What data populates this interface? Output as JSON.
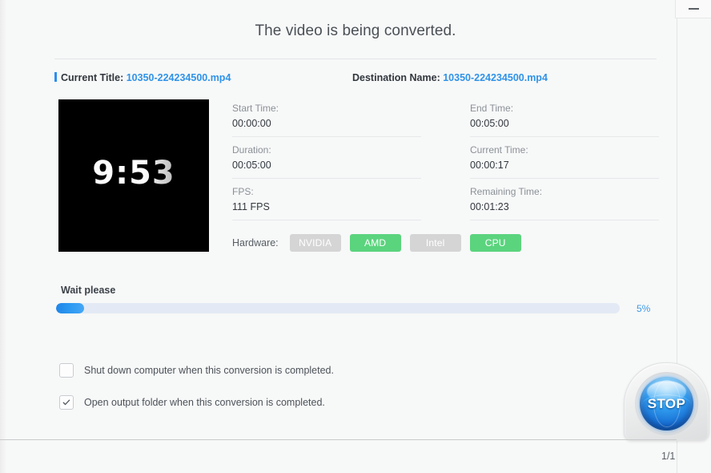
{
  "window": {
    "minimize_label": "minimize"
  },
  "header": {
    "title": "The video is being converted."
  },
  "title_row": {
    "current_label": "Current Title:",
    "current_value": "10350-224234500.mp4",
    "destination_label": "Destination Name:",
    "destination_value": "10350-224234500.mp4"
  },
  "preview": {
    "time_overlay": "9:53"
  },
  "info": {
    "left": [
      {
        "label": "Start Time:",
        "value": "00:00:00"
      },
      {
        "label": "Duration:",
        "value": "00:05:00"
      },
      {
        "label": "FPS:",
        "value": "111 FPS"
      }
    ],
    "right": [
      {
        "label": "End Time:",
        "value": "00:05:00"
      },
      {
        "label": "Current Time:",
        "value": "00:00:17"
      },
      {
        "label": "Remaining Time:",
        "value": "00:01:23"
      }
    ]
  },
  "hardware": {
    "label": "Hardware:",
    "badges": [
      {
        "name": "NVIDIA",
        "active": false
      },
      {
        "name": "AMD",
        "active": true
      },
      {
        "name": "Intel",
        "active": false
      },
      {
        "name": "CPU",
        "active": true
      }
    ],
    "active_color": "#5bd47e",
    "inactive_color": "#d5d5d5"
  },
  "progress": {
    "status_text": "Wait please",
    "percent_label": "5%",
    "percent_value": 5,
    "fill_color": "#2f9bf2",
    "track_color": "#e3eaf5"
  },
  "options": [
    {
      "label": "Shut down computer when this conversion is completed.",
      "checked": false
    },
    {
      "label": "Open output folder when this conversion is completed.",
      "checked": true
    }
  ],
  "stop_button": {
    "label": "STOP"
  },
  "footer": {
    "page_indicator": "1/1"
  },
  "theme": {
    "background": "#f7f8f8",
    "accent": "#2b8ef0",
    "link": "#2f93e8"
  }
}
